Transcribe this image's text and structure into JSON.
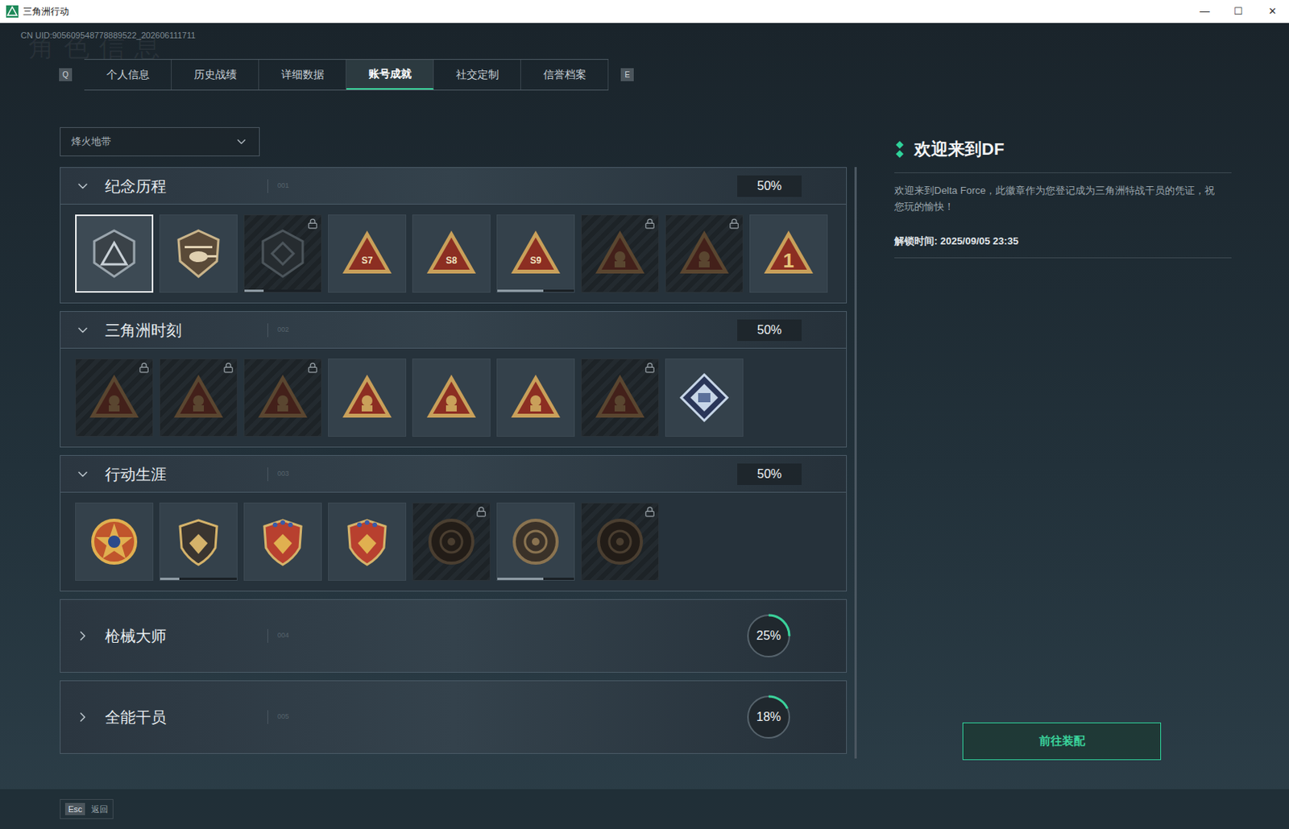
{
  "window": {
    "title": "三角洲行动",
    "controls": [
      "—",
      "☐",
      "✕"
    ]
  },
  "uid": "CN UID:905609548778889522_202606111711",
  "watermark": "角色信息",
  "keys": {
    "prev": "Q",
    "next": "E"
  },
  "tabs": [
    {
      "label": "个人信息",
      "selected": false
    },
    {
      "label": "历史战绩",
      "selected": false
    },
    {
      "label": "详细数据",
      "selected": false
    },
    {
      "label": "账号成就",
      "selected": true
    },
    {
      "label": "社交定制",
      "selected": false
    },
    {
      "label": "信誉档案",
      "selected": false
    }
  ],
  "filter": {
    "value": "烽火地带",
    "expanded": false
  },
  "sections": [
    {
      "title": "纪念历程",
      "index": "001",
      "progress": "50%",
      "level": 0.5,
      "expanded": true,
      "badges": [
        {
          "kind": "hex-triangle",
          "locked": false,
          "selected": true
        },
        {
          "kind": "heli-shield",
          "locked": false,
          "selected": false
        },
        {
          "kind": "hex-shield",
          "locked": true,
          "selected": false,
          "level": 0.25
        },
        {
          "kind": "triangle",
          "label": "S7",
          "locked": false,
          "selected": false
        },
        {
          "kind": "triangle",
          "label": "S8",
          "locked": false,
          "selected": false
        },
        {
          "kind": "triangle",
          "label": "S9",
          "locked": false,
          "selected": false,
          "level": 0.6
        },
        {
          "kind": "triangle",
          "locked": true,
          "selected": false
        },
        {
          "kind": "triangle",
          "locked": true,
          "selected": false
        },
        {
          "kind": "triangle",
          "label": "1",
          "locked": false,
          "selected": false
        }
      ]
    },
    {
      "title": "三角洲时刻",
      "index": "002",
      "progress": "50%",
      "level": 0.5,
      "expanded": true,
      "badges": [
        {
          "kind": "triangle",
          "locked": true,
          "selected": false
        },
        {
          "kind": "triangle",
          "locked": true,
          "selected": false
        },
        {
          "kind": "triangle",
          "locked": true,
          "selected": false
        },
        {
          "kind": "triangle",
          "locked": false,
          "selected": false
        },
        {
          "kind": "triangle",
          "locked": false,
          "selected": false
        },
        {
          "kind": "triangle",
          "locked": false,
          "selected": false
        },
        {
          "kind": "triangle",
          "locked": true,
          "selected": false
        },
        {
          "kind": "diamond",
          "locked": false,
          "selected": false
        }
      ]
    },
    {
      "title": "行动生涯",
      "index": "003",
      "progress": "50%",
      "level": 0.5,
      "expanded": true,
      "badges": [
        {
          "kind": "star-medal",
          "locked": false,
          "selected": false
        },
        {
          "kind": "shield",
          "locked": false,
          "selected": false,
          "level": 0.25
        },
        {
          "kind": "star-shield",
          "locked": false,
          "selected": false
        },
        {
          "kind": "star-shield",
          "locked": false,
          "selected": false
        },
        {
          "kind": "round",
          "locked": true,
          "selected": false
        },
        {
          "kind": "round",
          "locked": false,
          "selected": false,
          "level": 0.6
        },
        {
          "kind": "round",
          "locked": true,
          "selected": false
        }
      ]
    },
    {
      "title": "枪械大师",
      "index": "004",
      "progress": "25%",
      "level": 0.25,
      "expanded": false,
      "badges": []
    },
    {
      "title": "全能干员",
      "index": "005",
      "progress": "18%",
      "level": 0.18,
      "expanded": false,
      "badges": []
    }
  ],
  "detail": {
    "title": "欢迎来到DF",
    "description": "欢迎来到Delta Force，此徽章作为您登记成为三角洲特战干员的凭证，祝您玩的愉快！",
    "unlock": "解锁时间: 2025/09/05 23:35",
    "button": "前往装配"
  },
  "footer": {
    "key": "Esc",
    "label": "返回"
  }
}
